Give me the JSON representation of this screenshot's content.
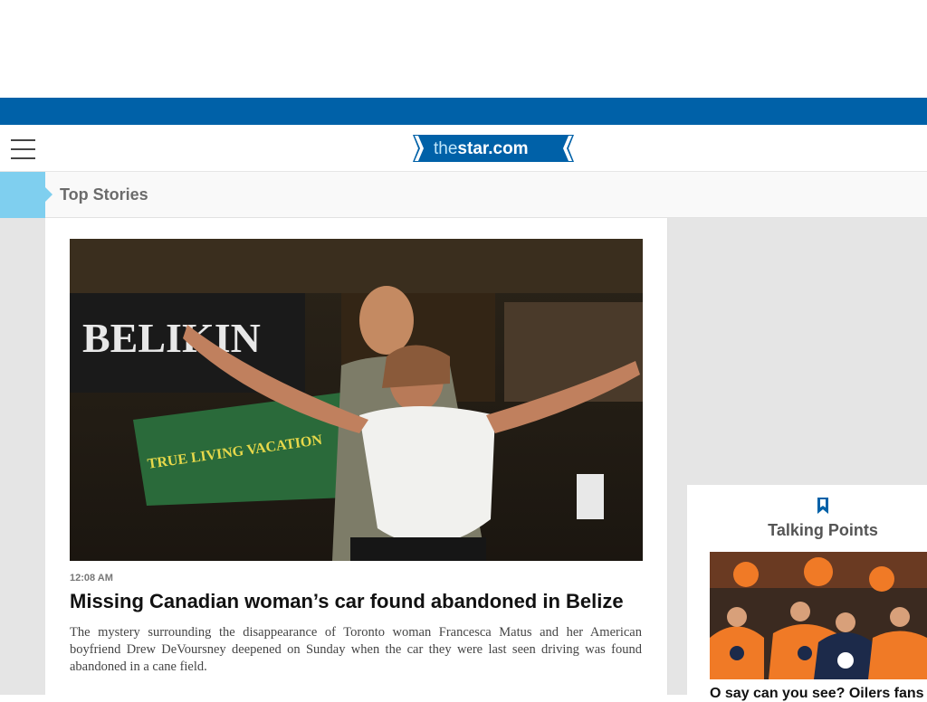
{
  "header": {
    "menu_label": "Menu",
    "logo_text_light": "the",
    "logo_text_bold": "star.com"
  },
  "section": {
    "title": "Top Stories"
  },
  "lead_story": {
    "timestamp": "12:08 AM",
    "headline": "Missing Canadian woman’s car found abandoned in Belize",
    "summary": "The mystery surrounding the disappearance of Toronto woman Francesca Matus and her American boyfriend Drew DeVoursney deepened on Sunday when the car they were last seen driving was found abandoned in a cane field.",
    "image_sign_text": "BELIKIN",
    "image_banner_text": "TRUE LIVING VACATION"
  },
  "talking_points": {
    "title": "Talking Points",
    "story_headline": "O say can you see? Oilers fans",
    "icon": "bookmark-icon"
  },
  "colors": {
    "brand_blue": "#0061a8",
    "section_accent": "#7fcfef"
  }
}
